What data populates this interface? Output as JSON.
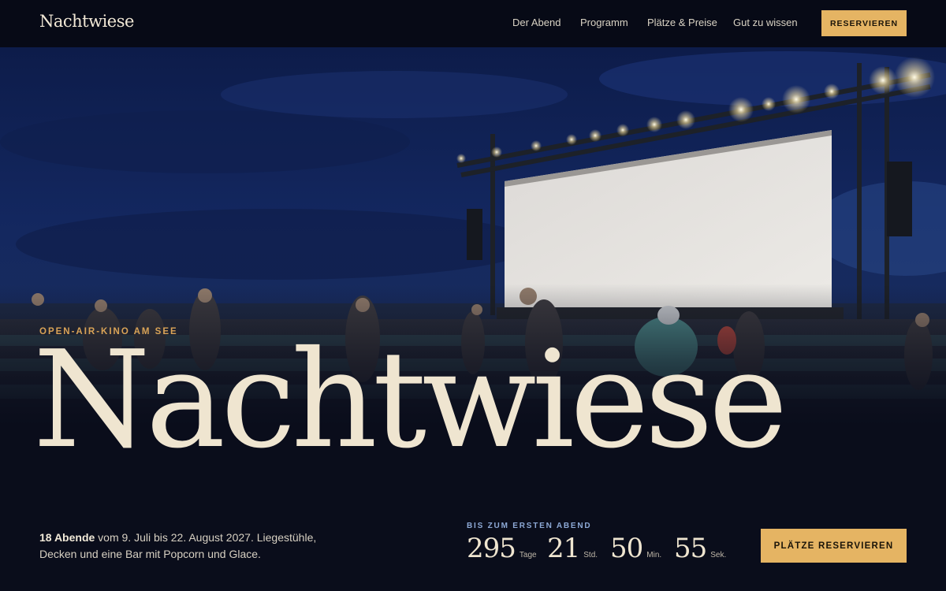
{
  "header": {
    "logo": "Nachtwiese",
    "nav": [
      "Der Abend",
      "Programm",
      "Plätze & Preise",
      "Gut zu wissen"
    ],
    "cta": "RESERVIEREN"
  },
  "hero": {
    "image": "open-air-cinema-screen-at-dusk",
    "eyebrow": "OPEN-AIR-KINO AM SEE",
    "title": "Nachtwiese"
  },
  "intro": {
    "highlight": "18 Abende",
    "text": " vom 9. Juli bis 22. August 2027. Liegestühle, Decken und eine Bar mit Popcorn und Glace."
  },
  "countdown": {
    "label": "BIS ZUM ERSTEN ABEND",
    "days": "295",
    "days_unit": "Tage",
    "hours": "21",
    "hours_unit": "Std.",
    "minutes": "50",
    "minutes_unit": "Min.",
    "seconds": "55",
    "seconds_unit": "Sek."
  },
  "cta_main": "PLÄTZE RESERVIEREN",
  "colors": {
    "background": "#0a0d1b",
    "accent": "#e5b463",
    "title": "#efe5d0",
    "eyebrow": "#d9a357"
  }
}
